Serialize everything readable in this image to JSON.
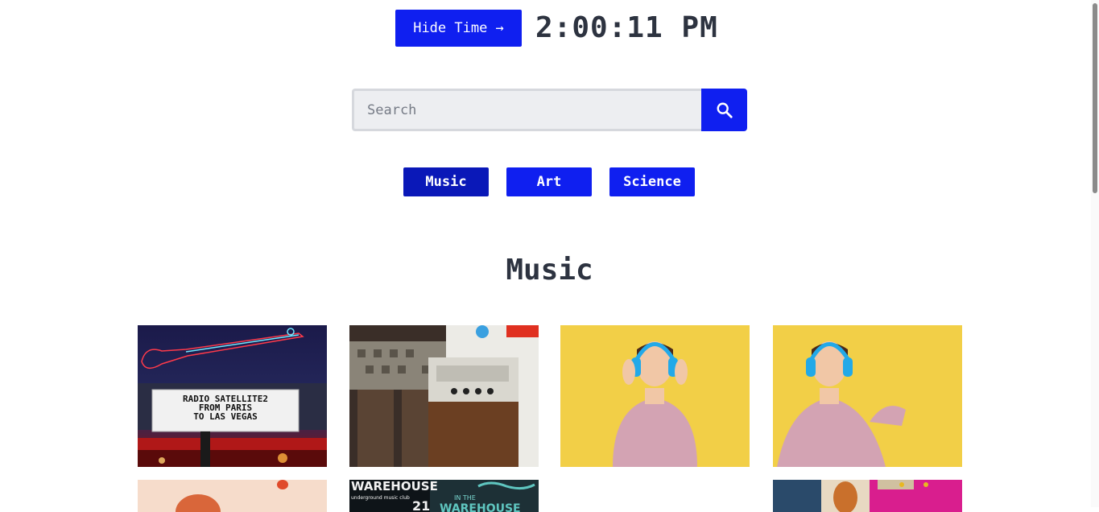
{
  "header": {
    "hide_time_label": "Hide Time →",
    "clock": "2:00:11 PM"
  },
  "search": {
    "placeholder": "Search",
    "value": "",
    "button_icon": "search-icon"
  },
  "categories": [
    {
      "label": "Music",
      "active": true
    },
    {
      "label": "Art",
      "active": false
    },
    {
      "label": "Science",
      "active": false
    }
  ],
  "section": {
    "title": "Music"
  },
  "gallery": {
    "row1": [
      {
        "name": "neon-guitar-marquee-image",
        "marquee_lines": [
          "RADIO SATELLITE2",
          "FROM PARIS",
          "TO LAS VEGAS"
        ]
      },
      {
        "name": "vintage-radio-legs-image"
      },
      {
        "name": "boy-headphones-image"
      },
      {
        "name": "boy-headphones-image-2"
      }
    ],
    "row2": [
      {
        "name": "balloon-image"
      },
      {
        "name": "warehouse-poster-image",
        "text": [
          "WAREHOUSE",
          "underground music club",
          "21",
          "IN THE",
          "WAREHOUSE"
        ]
      },
      {
        "name": "empty-tile"
      },
      {
        "name": "colorful-art-image"
      }
    ]
  },
  "colors": {
    "accent": "#0f1ff0",
    "accent_active": "#0a18b8",
    "text": "#2d3340",
    "input_bg": "#edeef1"
  }
}
